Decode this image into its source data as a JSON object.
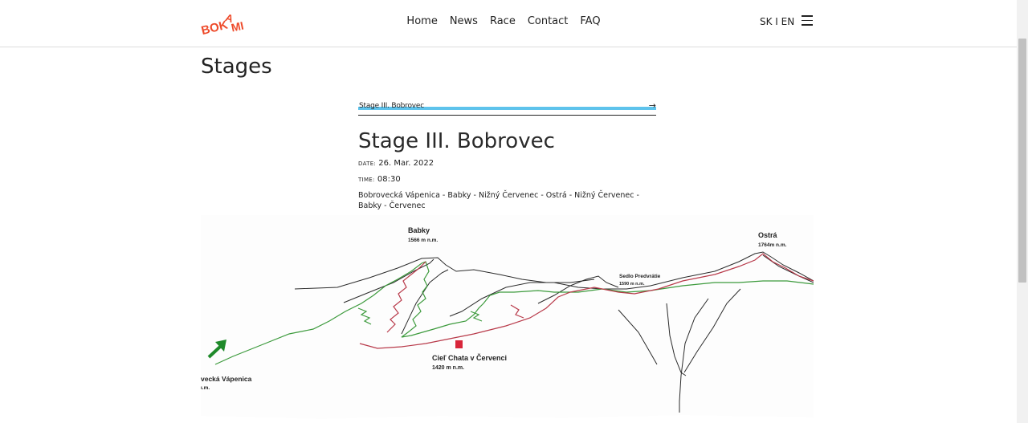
{
  "brand": {
    "logo_text": "BOKAMI",
    "color": "#ee4b2b"
  },
  "nav": {
    "items": [
      {
        "label": "Home",
        "active": false
      },
      {
        "label": "News",
        "active": false
      },
      {
        "label": "Race",
        "active": true
      },
      {
        "label": "Contact",
        "active": false
      },
      {
        "label": "FAQ",
        "active": false
      }
    ],
    "accent": "#5ec3ec"
  },
  "lang": "SK I EN",
  "menu_icon": "hamburger-icon",
  "page": {
    "title": "Stages"
  },
  "stage_link": {
    "label": "Stage III. Bobrovec",
    "arrow": "→"
  },
  "stage": {
    "title": "Stage III. Bobrovec",
    "date_label": "DATE:",
    "date": "26. Mar. 2022",
    "time_label": "TIME:",
    "time": "08:30",
    "route": "Bobrovecká Vápenica - Babky - Nižný Červenec - Ostrá - Nižný Červenec - Babky - Červenec"
  },
  "map": {
    "labels": {
      "babky": "Babky",
      "babky_alt": "1566 m n.m.",
      "ostra": "Ostrá",
      "ostra_alt": "1764m n.m.",
      "sedlo": "Sedlo Predvrátie",
      "sedlo_alt": "1590 m n.m.",
      "ciel": "Cieľ Chata v Červenci",
      "ciel_alt": "1420 m n.m.",
      "start": "vecká Vápenica",
      "start_alt": "ı.m."
    },
    "colors": {
      "green": "#3c9a3c",
      "red": "#b83a4a",
      "arrow": "#1f8a2a",
      "finish": "#d8263a"
    }
  }
}
